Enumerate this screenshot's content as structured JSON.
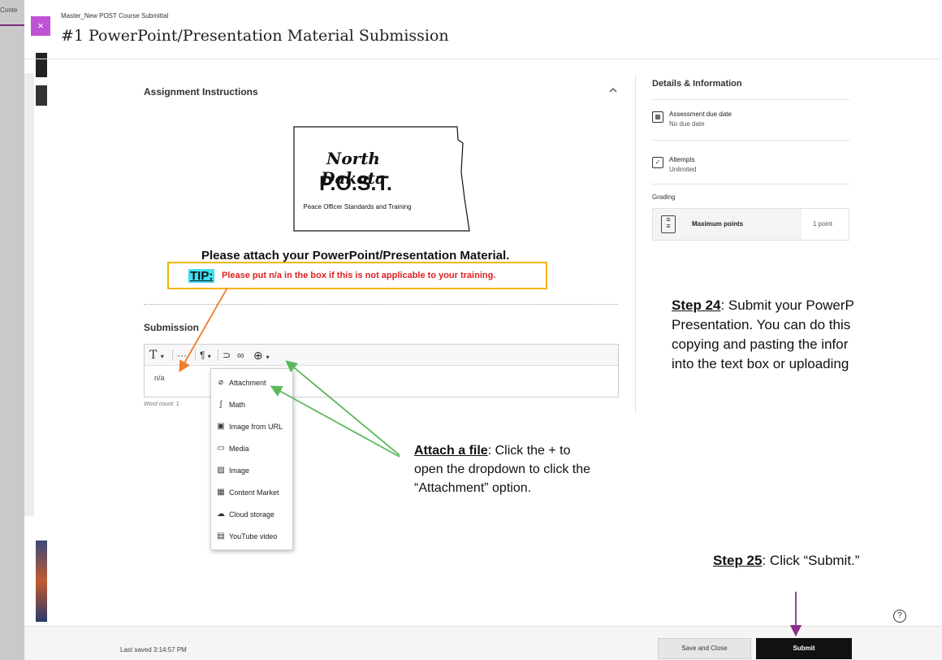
{
  "background": {
    "tab_label": "Conte"
  },
  "header": {
    "close_glyph": "×",
    "breadcrumb": "Master_New POST Course Submittal",
    "title": "#1 PowerPoint/Presentation Material Submission"
  },
  "instructions": {
    "heading": "Assignment Instructions",
    "logo": {
      "state_script": "North Dakota",
      "acronym": "P.O.S.T.",
      "subtitle": "Peace Officer Standards and Training"
    },
    "attach_heading": "Please attach your PowerPoint/Presentation Material.",
    "tip_label": "TIP:",
    "tip_text": "Please put n/a in the box if this is not applicable to your training."
  },
  "submission": {
    "heading": "Submission",
    "toolbar": {
      "text_style": "T",
      "more": "···",
      "paragraph": "¶",
      "undo": "⊃",
      "link": "∞",
      "insert": "⊕"
    },
    "editor_value": "n/a",
    "word_count": "Word count: 1"
  },
  "insert_menu": [
    {
      "icon": "paperclip-icon",
      "glyph": "⌀",
      "label": "Attachment"
    },
    {
      "icon": "math-icon",
      "glyph": "∫",
      "label": "Math"
    },
    {
      "icon": "image-url-icon",
      "glyph": "▣",
      "label": "Image from URL"
    },
    {
      "icon": "media-icon",
      "glyph": "▭",
      "label": "Media"
    },
    {
      "icon": "image-icon",
      "glyph": "▨",
      "label": "Image"
    },
    {
      "icon": "content-market-icon",
      "glyph": "▦",
      "label": "Content Market"
    },
    {
      "icon": "cloud-storage-icon",
      "glyph": "☁",
      "label": "Cloud storage"
    },
    {
      "icon": "youtube-icon",
      "glyph": "▤",
      "label": "YouTube video"
    }
  ],
  "details": {
    "heading": "Details & Information",
    "due_label": "Assessment due date",
    "due_value": "No due date",
    "attempts_label": "Attempts",
    "attempts_value": "Unlimited",
    "grading_label": "Grading",
    "grading_name": "Maximum points",
    "grading_value": "1 point"
  },
  "annotations": {
    "step24_label": "Step 24",
    "step24_line1": ": Submit your PowerP",
    "step24_line2": "Presentation. You can do this",
    "step24_line3": "copying and pasting the infor",
    "step24_line4": "into the text box or uploading",
    "step25_label": "Step 25",
    "step25_text": ": Click “Submit.”",
    "attach_label": "Attach a file",
    "attach_text": ": Click the + to open the dropdown to click the “Attachment” option.",
    "colors": {
      "tip_arrow": "#f07d2e",
      "attach_arrow": "#5cb85c",
      "submit_arrow": "#8b2d8b",
      "tip_border": "#f4b400",
      "tip_highlight": "#3de0f0",
      "tip_text": "#e02020"
    }
  },
  "footer": {
    "last_saved": "Last saved 3:14:57 PM",
    "save_close_label": "Save and Close",
    "submit_label": "Submit",
    "help_glyph": "?"
  }
}
